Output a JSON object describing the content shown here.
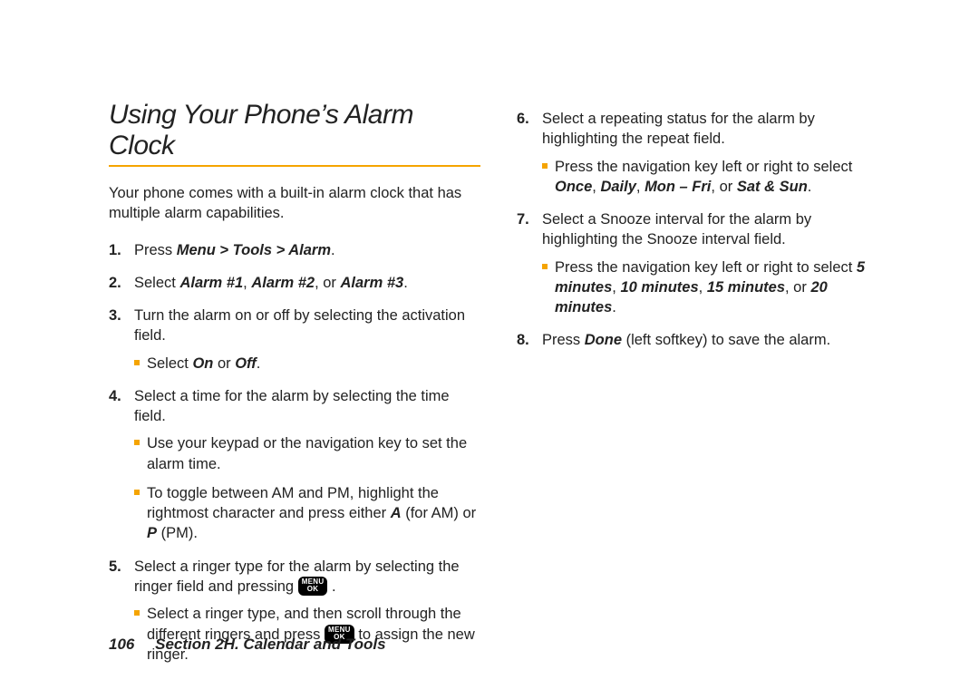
{
  "title": "Using Your Phone’s Alarm Clock",
  "intro": "Your phone comes with a built-in alarm clock that has multiple alarm capabilities.",
  "left_steps": [
    {
      "num": "1.",
      "runs": [
        {
          "t": "Press ",
          "cls": ""
        },
        {
          "t": "Menu > Tools > Alarm",
          "cls": "ital-bold"
        },
        {
          "t": ".",
          "cls": ""
        }
      ]
    },
    {
      "num": "2.",
      "runs": [
        {
          "t": "Select ",
          "cls": ""
        },
        {
          "t": "Alarm #1",
          "cls": "ital-bold"
        },
        {
          "t": ", ",
          "cls": ""
        },
        {
          "t": "Alarm #2",
          "cls": "ital-bold"
        },
        {
          "t": ", or ",
          "cls": ""
        },
        {
          "t": "Alarm #3",
          "cls": "ital-bold"
        },
        {
          "t": ".",
          "cls": ""
        }
      ]
    },
    {
      "num": "3.",
      "runs": [
        {
          "t": "Turn the alarm on or off by selecting the activation field.",
          "cls": ""
        }
      ],
      "sub": [
        {
          "runs": [
            {
              "t": "Select ",
              "cls": ""
            },
            {
              "t": "On",
              "cls": "ital-bold"
            },
            {
              "t": " or ",
              "cls": ""
            },
            {
              "t": "Off",
              "cls": "ital-bold"
            },
            {
              "t": ".",
              "cls": ""
            }
          ]
        }
      ]
    },
    {
      "num": "4.",
      "runs": [
        {
          "t": "Select a time for the alarm by selecting the time field.",
          "cls": ""
        }
      ],
      "sub": [
        {
          "runs": [
            {
              "t": "Use your keypad or the navigation key to set the alarm time.",
              "cls": ""
            }
          ]
        },
        {
          "runs": [
            {
              "t": "To toggle between AM and PM, highlight the rightmost character and press either ",
              "cls": ""
            },
            {
              "t": "A",
              "cls": "ital-bold"
            },
            {
              "t": " (for AM) or ",
              "cls": ""
            },
            {
              "t": "P",
              "cls": "ital-bold"
            },
            {
              "t": " (PM).",
              "cls": ""
            }
          ]
        }
      ]
    },
    {
      "num": "5.",
      "runs": [
        {
          "t": "Select a ringer type for the alarm by selecting the ringer field and pressing ",
          "cls": ""
        },
        {
          "btn": true
        },
        {
          "t": " .",
          "cls": ""
        }
      ],
      "sub": [
        {
          "runs": [
            {
              "t": "Select a ringer type, and then scroll through the different ringers and press ",
              "cls": ""
            },
            {
              "btn": true
            },
            {
              "t": "  to assign the new ringer.",
              "cls": ""
            }
          ]
        }
      ]
    }
  ],
  "right_steps": [
    {
      "num": "6.",
      "runs": [
        {
          "t": "Select a repeating status for the alarm by highlighting the repeat field.",
          "cls": ""
        }
      ],
      "sub": [
        {
          "runs": [
            {
              "t": "Press the navigation key left or right to select ",
              "cls": ""
            },
            {
              "t": "Once",
              "cls": "ital-bold"
            },
            {
              "t": ", ",
              "cls": ""
            },
            {
              "t": "Daily",
              "cls": "ital-bold"
            },
            {
              "t": ", ",
              "cls": ""
            },
            {
              "t": "Mon – Fri",
              "cls": "ital-bold"
            },
            {
              "t": ", or ",
              "cls": ""
            },
            {
              "t": "Sat & Sun",
              "cls": "ital-bold"
            },
            {
              "t": ".",
              "cls": ""
            }
          ]
        }
      ]
    },
    {
      "num": "7.",
      "runs": [
        {
          "t": "Select a Snooze interval for the alarm by highlighting the Snooze interval field.",
          "cls": ""
        }
      ],
      "sub": [
        {
          "runs": [
            {
              "t": "Press the navigation key left or right to select ",
              "cls": ""
            },
            {
              "t": "5 minutes",
              "cls": "ital-bold"
            },
            {
              "t": ", ",
              "cls": ""
            },
            {
              "t": "10 minutes",
              "cls": "ital-bold"
            },
            {
              "t": ", ",
              "cls": ""
            },
            {
              "t": "15 minutes",
              "cls": "ital-bold"
            },
            {
              "t": ", or ",
              "cls": ""
            },
            {
              "t": " 20 minutes",
              "cls": "ital-bold"
            },
            {
              "t": ".",
              "cls": ""
            }
          ]
        }
      ]
    },
    {
      "num": "8.",
      "runs": [
        {
          "t": "Press ",
          "cls": ""
        },
        {
          "t": "Done",
          "cls": "ital-bold"
        },
        {
          "t": " (left softkey) to save the alarm.",
          "cls": ""
        }
      ]
    }
  ],
  "menu_btn": {
    "line1": "MENU",
    "line2": "OK"
  },
  "footer": {
    "page": "106",
    "section": "Section 2H. Calendar and Tools"
  }
}
